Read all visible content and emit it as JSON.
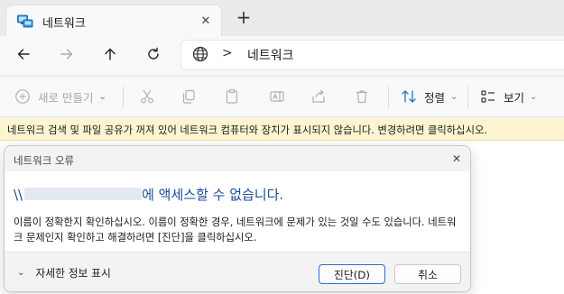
{
  "tab": {
    "title": "네트워크",
    "icon": "network-folder-icon"
  },
  "nav": {
    "back_icon": "arrow-left-icon",
    "forward_icon": "arrow-right-icon",
    "up_icon": "arrow-up-icon",
    "refresh_icon": "refresh-icon"
  },
  "breadcrumb": {
    "location": "네트워크",
    "separator": ">"
  },
  "toolbar": {
    "new_label": "새로 만들기",
    "sort_label": "정렬",
    "view_label": "보기"
  },
  "infobar": {
    "text": "네트워크 검색 및 파일 공유가 꺼져 있어 네트워크 컴퓨터와 장치가 표시되지 않습니다. 변경하려면 클릭하십시오."
  },
  "dialog": {
    "title": "네트워크 오류",
    "heading_prefix": "\\\\",
    "heading_suffix": "에 액세스할 수 없습니다.",
    "body": "이름이 정확한지 확인하십시오. 이름이 정확한 경우, 네트워크에 문제가 있는 것일 수도 있습니다. 네트워크 문제인지 확인하고 해결하려면 [진단]을 클릭하십시오.",
    "details_label": "자세한 정보 표시",
    "diagnose_label": "진단(D)",
    "cancel_label": "취소"
  },
  "colors": {
    "accent": "#2b6fd6",
    "heading": "#1a4c9a",
    "infobar_bg": "#fcf5d0"
  }
}
